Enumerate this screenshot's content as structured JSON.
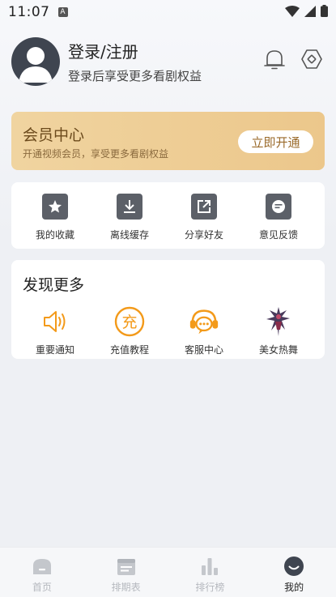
{
  "status_bar": {
    "time": "11:07",
    "notification_badge": "A"
  },
  "header": {
    "title": "登录/注册",
    "subtitle": "登录后享受更多看剧权益",
    "icons": [
      "notification-icon",
      "settings-icon"
    ]
  },
  "vip": {
    "title": "会员中心",
    "subtitle": "开通视频会员，享受更多看剧权益",
    "button_label": "立即开通"
  },
  "quick_actions": [
    {
      "label": "我的收藏",
      "icon": "star-icon"
    },
    {
      "label": "离线缓存",
      "icon": "download-icon"
    },
    {
      "label": "分享好友",
      "icon": "share-icon"
    },
    {
      "label": "意见反馈",
      "icon": "feedback-icon"
    }
  ],
  "discover": {
    "title": "发现更多",
    "items": [
      {
        "label": "重要通知",
        "icon": "speaker-icon"
      },
      {
        "label": "充值教程",
        "icon": "recharge-icon",
        "icon_text": "充"
      },
      {
        "label": "客服中心",
        "icon": "customer-service-icon"
      },
      {
        "label": "美女热舞",
        "icon": "dance-thumbnail-icon"
      }
    ]
  },
  "bottom_nav": [
    {
      "label": "首页",
      "icon": "home-icon",
      "active": false
    },
    {
      "label": "排期表",
      "icon": "schedule-icon",
      "active": false
    },
    {
      "label": "排行榜",
      "icon": "ranking-icon",
      "active": false
    },
    {
      "label": "我的",
      "icon": "profile-icon",
      "active": true
    }
  ],
  "colors": {
    "accent_orange": "#f39a1a",
    "vip_gold": "#ecc78b",
    "icon_gray": "#5c6068",
    "nav_inactive": "#b5b8be"
  }
}
